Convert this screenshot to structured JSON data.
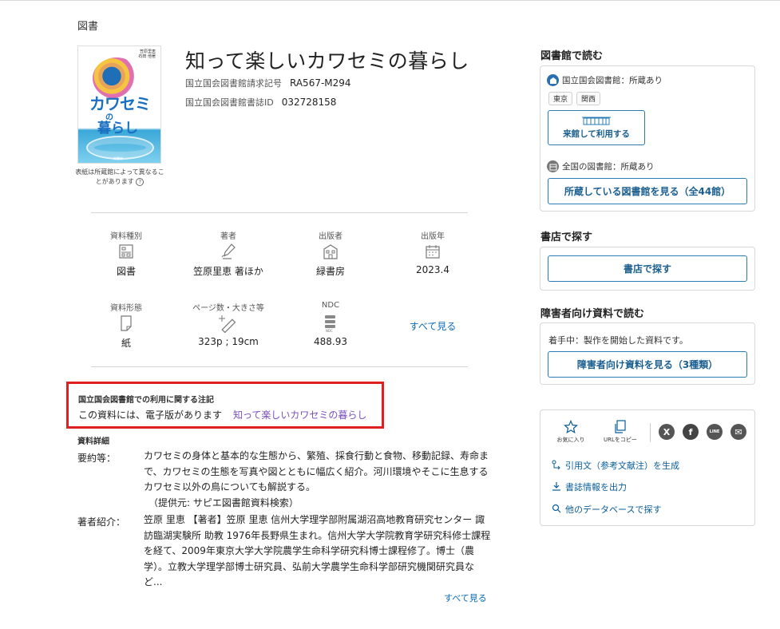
{
  "page": {
    "type_label": "図書"
  },
  "book": {
    "title": "知って楽しいカワセミの暮らし",
    "call_number_label": "国立国会図書館請求記号",
    "call_number": "RA567-M294",
    "bib_id_label": "国立国会図書館書誌ID",
    "bib_id": "032728158",
    "cover": {
      "title_line1": "カワセミ",
      "title_line2": "の",
      "title_line3": "暮らし",
      "authors": "笠原里恵\n石田 他著",
      "top_text": "知って楽しい",
      "publisher": "緑書房"
    },
    "cover_note": "表紙は所蔵館によって異なることがあります"
  },
  "attributes": [
    {
      "label": "資料種別",
      "value": "図書",
      "icon": "material-type-icon"
    },
    {
      "label": "著者",
      "value": "笠原里恵 著ほか",
      "icon": "author-pen-icon"
    },
    {
      "label": "出版者",
      "value": "緑書房",
      "icon": "publisher-building-icon"
    },
    {
      "label": "出版年",
      "value": "2023.4",
      "icon": "calendar-icon"
    },
    {
      "label": "資料形態",
      "value": "紙",
      "icon": "paper-icon"
    },
    {
      "label": "ページ数・大きさ等",
      "value": "323p ; 19cm",
      "icon": "ruler-icon"
    },
    {
      "label": "NDC",
      "value": "488.93",
      "icon": "ndc-icon"
    }
  ],
  "attributes_more": "すべて見る",
  "note": {
    "heading": "国立国会図書館での利用に関する注記",
    "text": "この資料には、電子版があります",
    "link": "知って楽しいカワセミの暮らし"
  },
  "details": {
    "heading": "資料詳細",
    "summary_label": "要約等：",
    "summary_lines": [
      "カワセミの身体と基本的な生態から、繁殖、採食行動と食物、移動記録、寿命ま",
      "で、カワセミの生態を写真や図とともに幅広く紹介。河川環境やそこに生息する",
      "カワセミ以外の鳥についても解説する。",
      "（提供元: サピエ図書館資料検索）"
    ],
    "author_label": "著者紹介：",
    "author_lines": [
      "笠原 里恵 【著者】笠原 里恵 信州大学理学部附属湖沼高地教育研究センター 諏",
      "訪臨湖実験所 助教 1976年長野県生まれ。信州大学大学院教育学研究科修士課程",
      "を経て、2009年東京大学大学院農学生命科学研究科博士課程修了。博士（農",
      "学）。立教大学理学部博士研究員、弘前大学農学生命科学部研究機関研究員な",
      "ど..."
    ],
    "see_all": "すべて見る"
  },
  "library": {
    "heading": "図書館で読む",
    "ndl_status": "国立国会図書館：所蔵あり",
    "tags": [
      "東京",
      "関西"
    ],
    "visit_button": "来館して利用する",
    "national_status": "全国の図書館：所蔵あり",
    "holdings_button": "所蔵している図書館を見る（全44館）"
  },
  "bookstore": {
    "heading": "書店で探す",
    "button": "書店で探す"
  },
  "accessible": {
    "heading": "障害者向け資料で読む",
    "status": "着手中：製作を開始した資料です。",
    "button": "障害者向け資料を見る（3種類）"
  },
  "share": {
    "favorite": "お気に入り",
    "copy_url": "URLをコピー",
    "sns": [
      "X",
      "f",
      "LINE",
      "✉"
    ],
    "citation": "引用文（参考文献注）を生成",
    "export": "書誌情報を出力",
    "other_db": "他のデータベースで探す"
  }
}
